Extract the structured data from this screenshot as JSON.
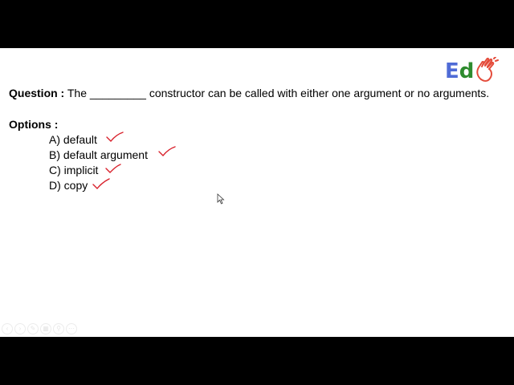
{
  "logo": {
    "letter_e": "E",
    "letter_d": "d",
    "colors": {
      "e": "#4f6bd6",
      "d": "#2e8b2e",
      "hand": "#e44b3a"
    },
    "hand_icon": "clapping-hands-icon"
  },
  "question": {
    "label": "Question :",
    "text": " The _________ constructor can be called with either one argument or no arguments."
  },
  "options": {
    "label": "Options :",
    "items": [
      {
        "text": "A) default"
      },
      {
        "text": "B) default argument"
      },
      {
        "text": "C) implicit"
      },
      {
        "text": "D) copy"
      }
    ]
  },
  "annotation_color": "#d81f2a",
  "nav_icons": [
    "prev-icon",
    "next-icon",
    "pen-icon",
    "slides-icon",
    "zoom-icon",
    "more-icon"
  ]
}
